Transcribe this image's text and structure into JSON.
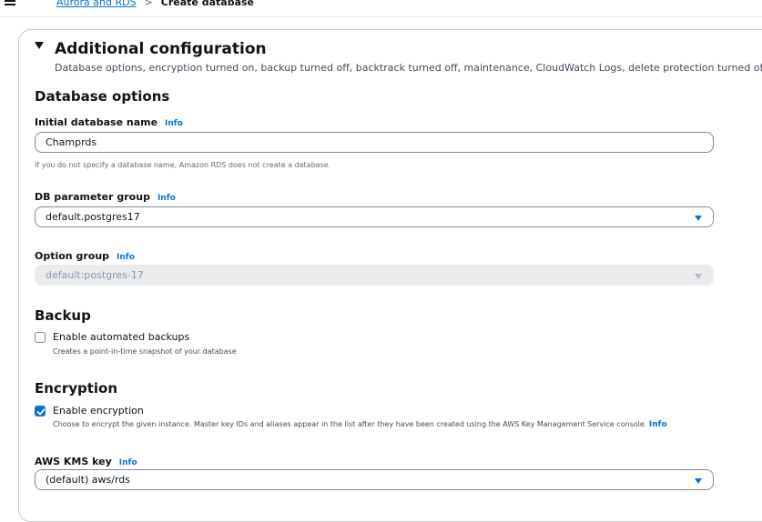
{
  "breadcrumb": {
    "link": "Aurora and RDS",
    "separator": ">",
    "current": "Create database"
  },
  "section": {
    "title": "Additional configuration",
    "description": "Database options, encryption turned on, backup turned off, backtrack turned off, maintenance, CloudWatch Logs, delete protection turned off."
  },
  "database_options": {
    "heading": "Database options",
    "initial_name": {
      "label": "Initial database name",
      "info": "Info",
      "value": "Champrds",
      "help": "If you do not specify a database name, Amazon RDS does not create a database."
    },
    "parameter_group": {
      "label": "DB parameter group",
      "info": "Info",
      "value": "default.postgres17"
    },
    "option_group": {
      "label": "Option group",
      "info": "Info",
      "value": "default:postgres-17"
    }
  },
  "backup": {
    "heading": "Backup",
    "checkbox_label": "Enable automated backups",
    "checkbox_desc": "Creates a point-in-time snapshot of your database",
    "checked": false
  },
  "encryption": {
    "heading": "Encryption",
    "checkbox_label": "Enable encryption",
    "checkbox_desc": "Choose to encrypt the given instance. Master key IDs and aliases appear in the list after they have been created using the AWS Key Management Service console.",
    "info": "Info",
    "checked": true,
    "kms": {
      "label": "AWS KMS key",
      "info": "Info",
      "value": "(default) aws/rds"
    }
  },
  "colors": {
    "link": "#0972d3",
    "text": "#0f141a",
    "border": "#7d8998"
  },
  "icons": [
    "menu-icon",
    "caret-down-icon",
    "dropdown-arrow-icon",
    "checkmark-icon"
  ]
}
